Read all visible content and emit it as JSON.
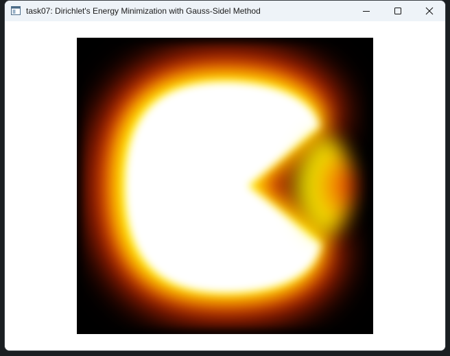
{
  "window": {
    "title": "task07: Dirichlet's Energy Minimization with Gauss-Sidel Method"
  },
  "caption_buttons": {
    "minimize": "minimize-icon",
    "maximize": "maximize-icon",
    "close": "close-icon"
  },
  "render": {
    "colormap": [
      "#000000",
      "#ff0000",
      "#ffff00",
      "#ffffff"
    ]
  }
}
